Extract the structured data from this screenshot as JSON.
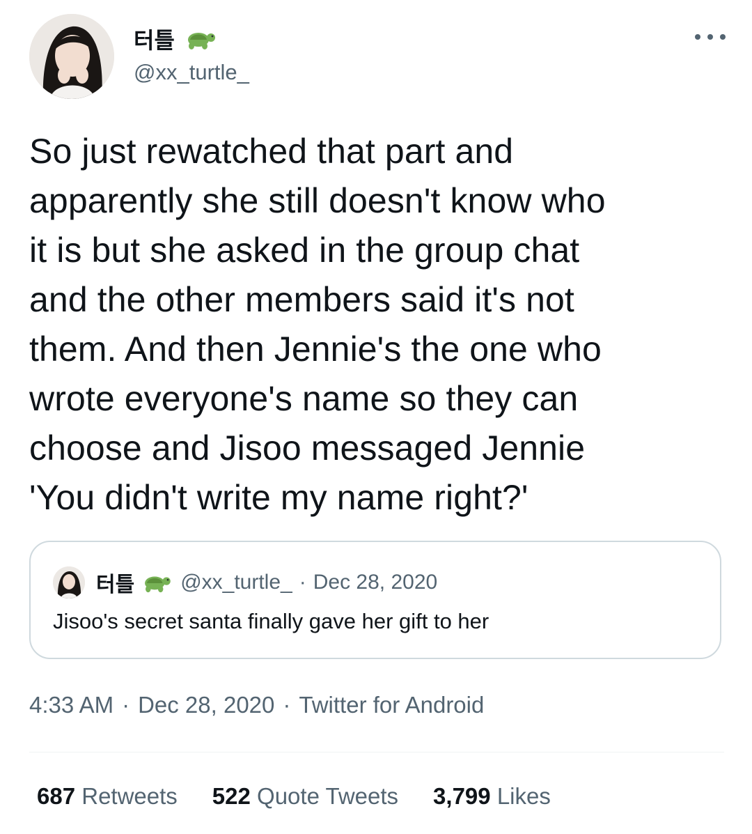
{
  "author": {
    "display_name": "터틀",
    "handle": "@xx_turtle_",
    "avatar_icon": "profile-photo",
    "badge_icon": "turtle-emoji"
  },
  "tweet": {
    "text": "So just rewatched that part and\napparently she still doesn't know who\nit is but she asked in the group chat\nand the other members said it's not\nthem. And then Jennie's the one who\nwrote everyone's name so they can\nchoose and Jisoo messaged Jennie\n'You didn't write my name right?'"
  },
  "quote": {
    "display_name": "터틀",
    "handle": "@xx_turtle_",
    "separator": "·",
    "date": "Dec 28, 2020",
    "text": "Jisoo's secret santa finally gave her gift to her"
  },
  "meta": {
    "time": "4:33 AM",
    "separator": "·",
    "date": "Dec 28, 2020",
    "source": "Twitter for Android"
  },
  "stats": {
    "retweets_count": "687",
    "retweets_label": "Retweets",
    "quotes_count": "522",
    "quotes_label": "Quote Tweets",
    "likes_count": "3,799",
    "likes_label": "Likes"
  },
  "colors": {
    "text_primary": "#0f1419",
    "text_secondary": "#536471",
    "border": "#cfd9de",
    "divider": "#eff3f4"
  }
}
